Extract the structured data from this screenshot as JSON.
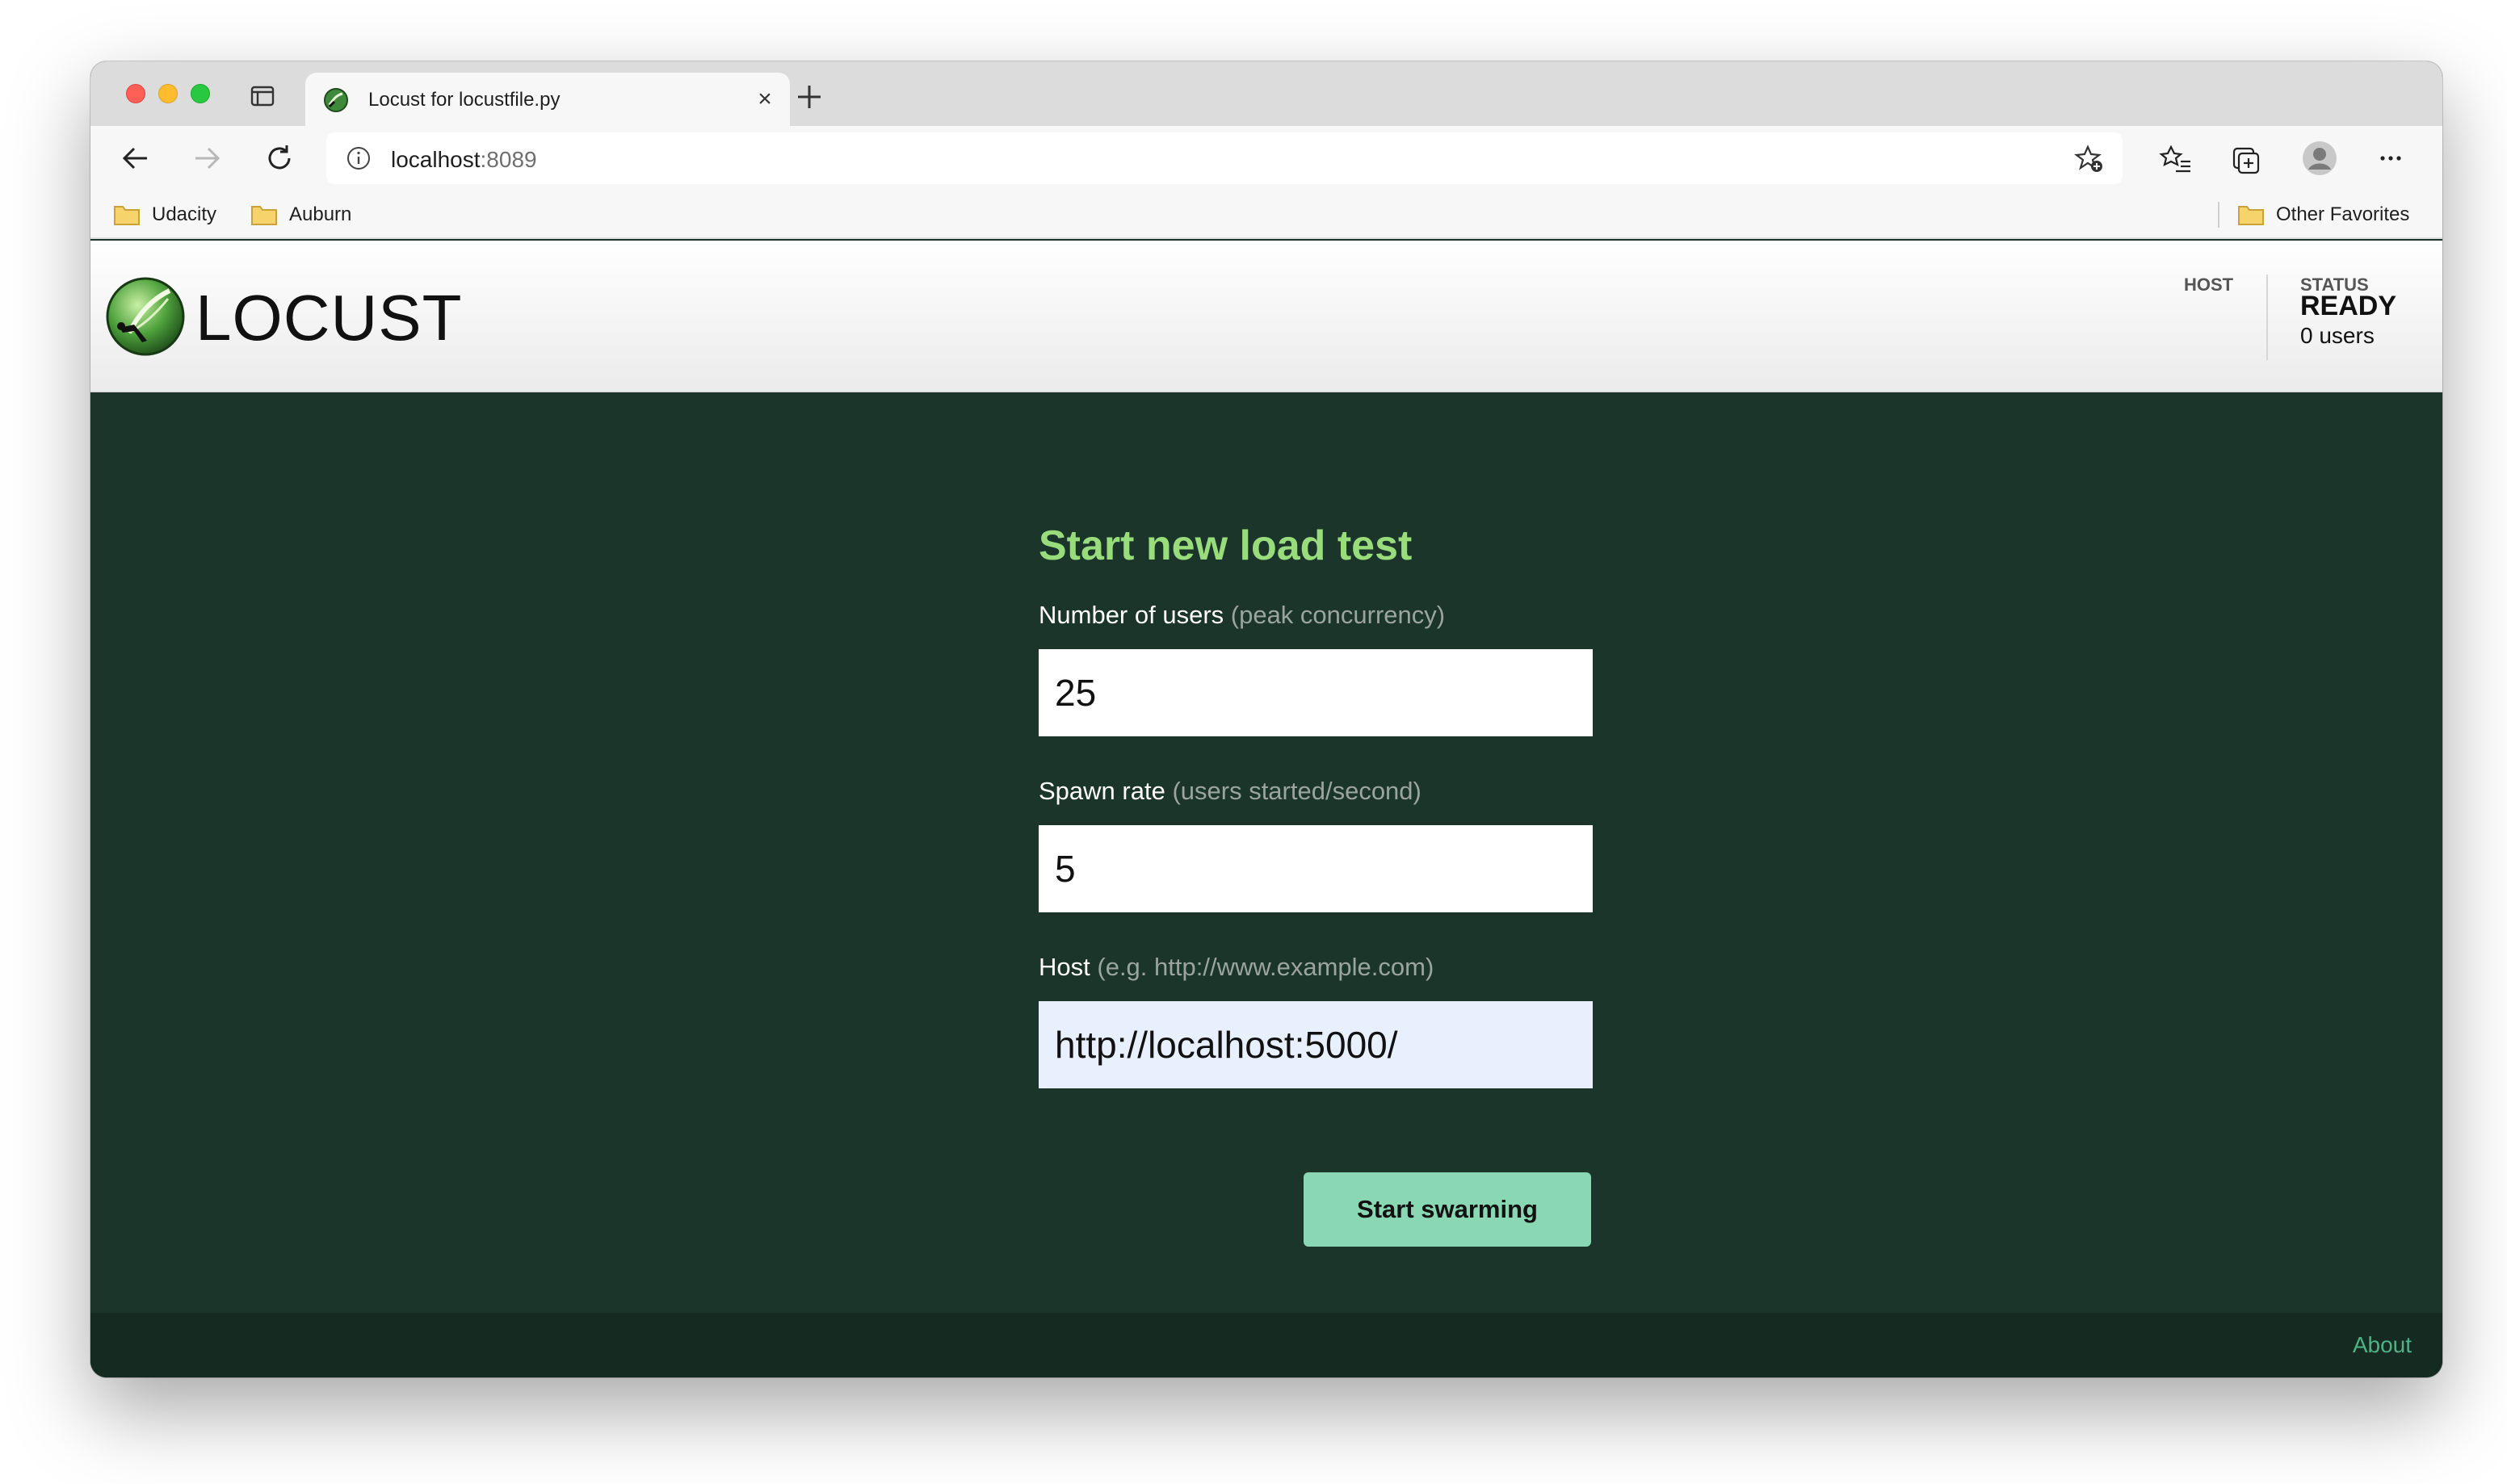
{
  "browser": {
    "tab": {
      "title": "Locust for locustfile.py",
      "close_symbol": "×"
    },
    "address": {
      "host": "localhost",
      "port": ":8089"
    },
    "bookmarks": {
      "items": [
        {
          "label": "Udacity",
          "icon": "folder-icon"
        },
        {
          "label": "Auburn",
          "icon": "folder-icon"
        }
      ],
      "other": "Other Favorites"
    },
    "icons": [
      "back-icon",
      "forward-icon",
      "reload-icon",
      "info-icon",
      "add-favorite-icon",
      "favorites-icon",
      "collections-icon",
      "profile-icon",
      "more-icon"
    ]
  },
  "locust": {
    "wordmark": "LOCUST",
    "header": {
      "host_label": "HOST",
      "status_label": "STATUS",
      "status_value": "READY",
      "users": "0 users"
    },
    "form": {
      "title": "Start new load test",
      "users": {
        "label": "Number of users",
        "hint": "(peak concurrency)",
        "value": "25"
      },
      "spawn": {
        "label": "Spawn rate",
        "hint": "(users started/second)",
        "value": "5"
      },
      "host": {
        "label": "Host",
        "hint": "(e.g. http://www.example.com)",
        "value": "http://localhost:5000/"
      },
      "submit_label": "Start swarming"
    },
    "footer": {
      "about_label": "About"
    }
  },
  "colors": {
    "main_bg": "#1b352a",
    "footer_bg": "#152a20",
    "title_green": "#98dc7c",
    "button_bg": "#8ad8b3",
    "about_link": "#4fb286"
  }
}
